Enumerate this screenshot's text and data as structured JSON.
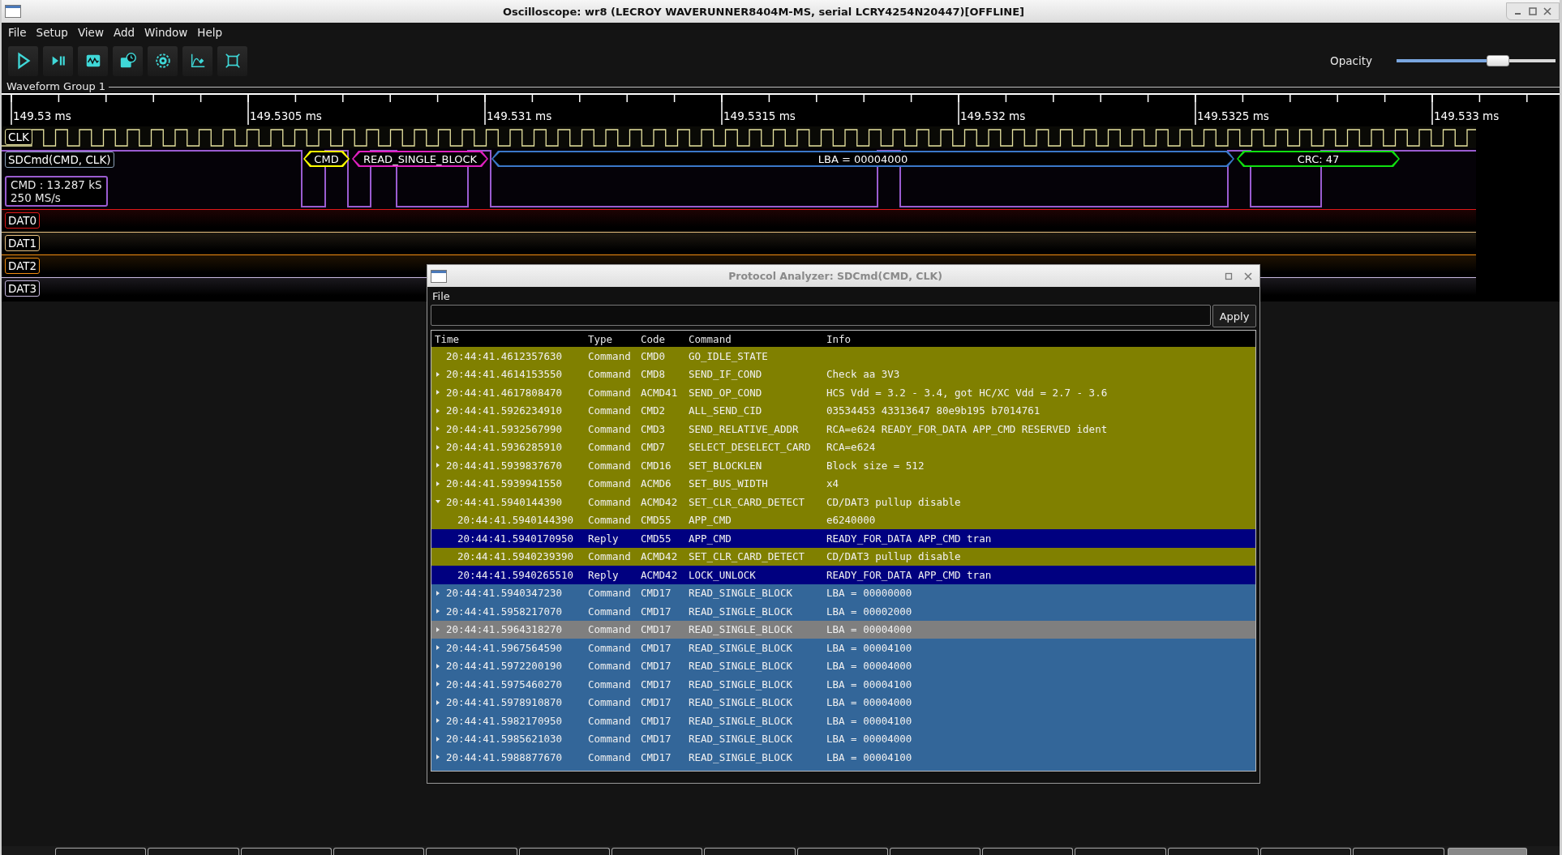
{
  "window": {
    "title": "Oscilloscope: wr8 (LECROY WAVERUNNER8404M-MS, serial LCRY4254N20447)[OFFLINE]"
  },
  "menu": [
    "File",
    "Setup",
    "View",
    "Add",
    "Window",
    "Help"
  ],
  "opacity": {
    "label": "Opacity",
    "level": 0.66
  },
  "bottom_tabs": [
    {
      "selected": false
    },
    {
      "selected": false
    },
    {
      "selected": false
    },
    {
      "selected": false
    },
    {
      "selected": false
    },
    {
      "selected": false
    },
    {
      "selected": false
    },
    {
      "selected": false
    },
    {
      "selected": false
    },
    {
      "selected": false
    },
    {
      "selected": false
    },
    {
      "selected": false
    },
    {
      "selected": false
    },
    {
      "selected": false
    },
    {
      "selected": false
    },
    {
      "selected": true
    }
  ],
  "waveform_group": {
    "title": "Waveform Group 1",
    "ruler": [
      "149.53 ms",
      "149.5305 ms",
      "149.531 ms",
      "149.5315 ms",
      "149.532 ms",
      "149.5325 ms",
      "149.533 ms"
    ],
    "traces": [
      {
        "kind": "clock",
        "label": "CLK",
        "color": "#e8e4a0"
      },
      {
        "kind": "decode",
        "label": "SDCmd(CMD, CLK)",
        "color": "#9a5cd0",
        "info": [
          "CMD : 13.287 kS",
          "250 MS/s"
        ],
        "packets": [
          {
            "text": "CMD",
            "color": "#ffff00"
          },
          {
            "text": "READ_SINGLE_BLOCK",
            "color": "#e020c0"
          },
          {
            "text": "LBA = 00004000",
            "color": "#3a78c8"
          },
          {
            "text": "CRC: 47",
            "color": "#10e010"
          }
        ]
      },
      {
        "kind": "data",
        "label": "DAT0",
        "color": "#e01818"
      },
      {
        "kind": "data",
        "label": "DAT1",
        "color": "#e8c080"
      },
      {
        "kind": "data",
        "label": "DAT2",
        "color": "#f08c10"
      },
      {
        "kind": "data",
        "label": "DAT3",
        "color": "#c8b8e0"
      }
    ]
  },
  "analyzer": {
    "title": "Protocol Analyzer: SDCmd(CMD, CLK)",
    "menu": [
      "File"
    ],
    "filter": {
      "button": "Apply"
    },
    "columns": [
      "Time",
      "Type",
      "Code",
      "Command",
      "Info"
    ],
    "rows": [
      {
        "time": "20:44:41.4612357630",
        "type": "Command",
        "code": "CMD0",
        "command": "GO_IDLE_STATE",
        "color": "#808000",
        "selected": false
      },
      {
        "time": "20:44:41.4614153550",
        "type": "Command",
        "code": "CMD8",
        "command": "SEND_IF_COND",
        "info": "Check aa 3V3",
        "color": "#808000",
        "selected": false,
        "expanded": false
      },
      {
        "time": "20:44:41.4617808470",
        "type": "Command",
        "code": "ACMD41",
        "command": "SEND_OP_COND",
        "info": "HCS Vdd = 3.2 - 3.4, got HC/XC Vdd = 2.7 - 3.6",
        "color": "#808000",
        "selected": false,
        "expanded": false
      },
      {
        "time": "20:44:41.5926234910",
        "type": "Command",
        "code": "CMD2",
        "command": "ALL_SEND_CID",
        "info": "03534453 43313647 80e9b195 b7014761",
        "color": "#808000",
        "selected": false,
        "expanded": false
      },
      {
        "time": "20:44:41.5932567990",
        "type": "Command",
        "code": "CMD3",
        "command": "SEND_RELATIVE_ADDR",
        "info": "RCA=e624 READY_FOR_DATA APP_CMD RESERVED ident",
        "color": "#808000",
        "selected": false,
        "expanded": false
      },
      {
        "time": "20:44:41.5936285910",
        "type": "Command",
        "code": "CMD7",
        "command": "SELECT_DESELECT_CARD",
        "info": "RCA=e624",
        "color": "#808000",
        "selected": false,
        "expanded": false
      },
      {
        "time": "20:44:41.5939837670",
        "type": "Command",
        "code": "CMD16",
        "command": "SET_BLOCKLEN",
        "info": "Block size = 512",
        "color": "#808000",
        "selected": false,
        "expanded": false
      },
      {
        "time": "20:44:41.5939941550",
        "type": "Command",
        "code": "ACMD6",
        "command": "SET_BUS_WIDTH",
        "info": "x4",
        "color": "#808000",
        "selected": false,
        "expanded": false
      },
      {
        "time": "20:44:41.5940144390",
        "type": "Command",
        "code": "ACMD42",
        "command": "SET_CLR_CARD_DETECT",
        "info": "CD/DAT3 pullup disable",
        "color": "#808000",
        "selected": false,
        "expanded": true,
        "children": [
          {
            "time": "20:44:41.5940144390",
            "type": "Command",
            "code": "CMD55",
            "command": "APP_CMD",
            "info": "e6240000",
            "color": "#808000",
            "selected": false
          },
          {
            "time": "20:44:41.5940170950",
            "type": "Reply",
            "code": "CMD55",
            "command": "APP_CMD",
            "info": "READY_FOR_DATA APP_CMD tran",
            "color": "#000080",
            "selected": false
          },
          {
            "time": "20:44:41.5940239390",
            "type": "Command",
            "code": "ACMD42",
            "command": "SET_CLR_CARD_DETECT",
            "info": "CD/DAT3 pullup disable",
            "color": "#808000",
            "selected": false
          },
          {
            "time": "20:44:41.5940265510",
            "type": "Reply",
            "code": "ACMD42",
            "command": "LOCK_UNLOCK",
            "info": "READY_FOR_DATA APP_CMD tran",
            "color": "#000080",
            "selected": false
          }
        ]
      },
      {
        "time": "20:44:41.5940347230",
        "type": "Command",
        "code": "CMD17",
        "command": "READ_SINGLE_BLOCK",
        "info": "LBA = 00000000",
        "color": "#336699",
        "selected": false,
        "expanded": false
      },
      {
        "time": "20:44:41.5958217070",
        "type": "Command",
        "code": "CMD17",
        "command": "READ_SINGLE_BLOCK",
        "info": "LBA = 00002000",
        "color": "#336699",
        "selected": false,
        "expanded": false
      },
      {
        "time": "20:44:41.5964318270",
        "type": "Command",
        "code": "CMD17",
        "command": "READ_SINGLE_BLOCK",
        "info": "LBA = 00004000",
        "selected": true,
        "expanded": false
      },
      {
        "time": "20:44:41.5967564590",
        "type": "Command",
        "code": "CMD17",
        "command": "READ_SINGLE_BLOCK",
        "info": "LBA = 00004100",
        "color": "#336699",
        "selected": false,
        "expanded": false
      },
      {
        "time": "20:44:41.5972200190",
        "type": "Command",
        "code": "CMD17",
        "command": "READ_SINGLE_BLOCK",
        "info": "LBA = 00004000",
        "color": "#336699",
        "selected": false,
        "expanded": false
      },
      {
        "time": "20:44:41.5975460270",
        "type": "Command",
        "code": "CMD17",
        "command": "READ_SINGLE_BLOCK",
        "info": "LBA = 00004100",
        "color": "#336699",
        "selected": false,
        "expanded": false
      },
      {
        "time": "20:44:41.5978910870",
        "type": "Command",
        "code": "CMD17",
        "command": "READ_SINGLE_BLOCK",
        "info": "LBA = 00004000",
        "color": "#336699",
        "selected": false,
        "expanded": false
      },
      {
        "time": "20:44:41.5982170950",
        "type": "Command",
        "code": "CMD17",
        "command": "READ_SINGLE_BLOCK",
        "info": "LBA = 00004100",
        "color": "#336699",
        "selected": false,
        "expanded": false
      },
      {
        "time": "20:44:41.5985621030",
        "type": "Command",
        "code": "CMD17",
        "command": "READ_SINGLE_BLOCK",
        "info": "LBA = 00004000",
        "color": "#336699",
        "selected": false,
        "expanded": false
      },
      {
        "time": "20:44:41.5988877670",
        "type": "Command",
        "code": "CMD17",
        "command": "READ_SINGLE_BLOCK",
        "info": "LBA = 00004100",
        "color": "#336699",
        "selected": false,
        "expanded": false
      }
    ]
  }
}
